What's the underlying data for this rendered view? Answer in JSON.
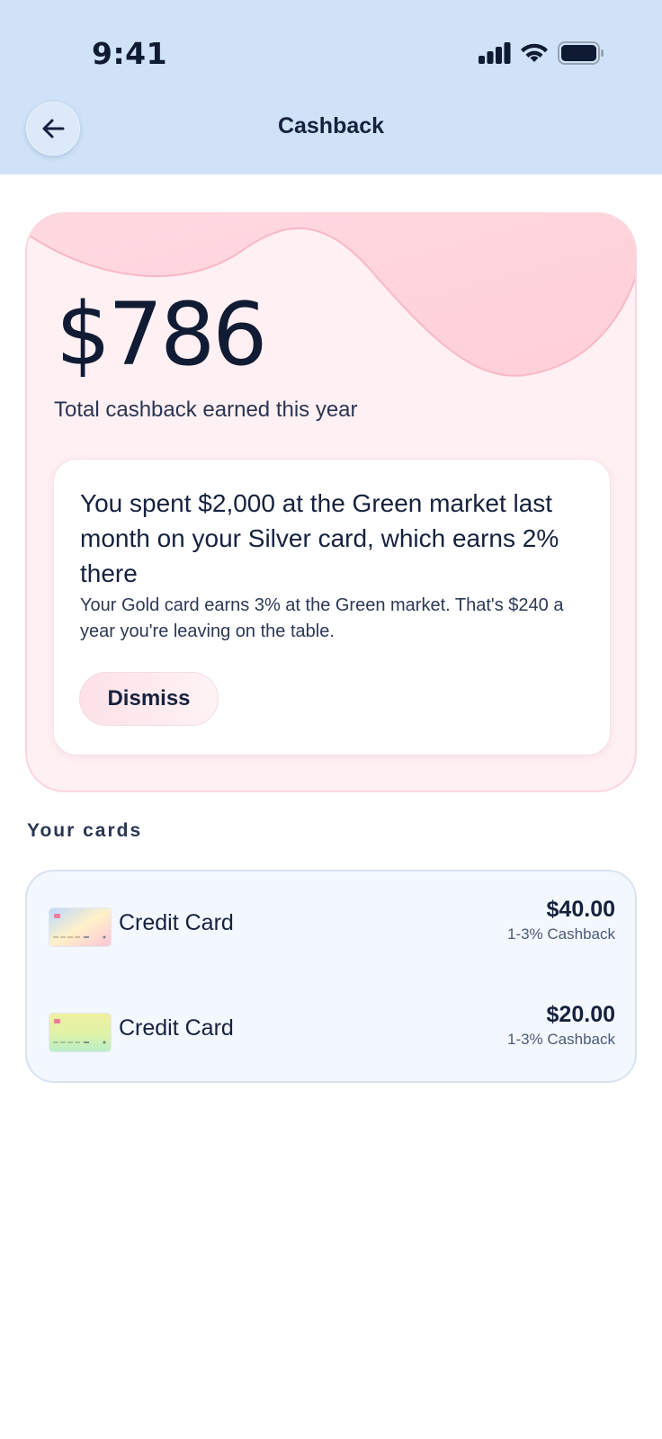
{
  "status_bar": {
    "time": "9:41"
  },
  "header": {
    "title": "Cashback",
    "back_icon": "arrow-left-icon"
  },
  "summary": {
    "amount": "$786",
    "label": "Total cashback earned this year"
  },
  "insight": {
    "title": "You spent $2,000 at the Green market last month on your Silver card, which earns 2% there",
    "body": "Your Gold card earns 3% at the Green market. That's $240 a year you're leaving on the table.",
    "dismiss_label": "Dismiss"
  },
  "cards_section": {
    "label": "Your cards",
    "items": [
      {
        "name": "Credit Card",
        "amount": "$40.00",
        "rate": "1-3% Cashback"
      },
      {
        "name": "Credit Card",
        "amount": "$20.00",
        "rate": "1-3% Cashback"
      }
    ]
  },
  "colors": {
    "header_bg": "#cfe2f7",
    "summary_bg": "#fff0f3",
    "text_primary": "#16213e",
    "cards_bg": "#f3f7fe"
  }
}
